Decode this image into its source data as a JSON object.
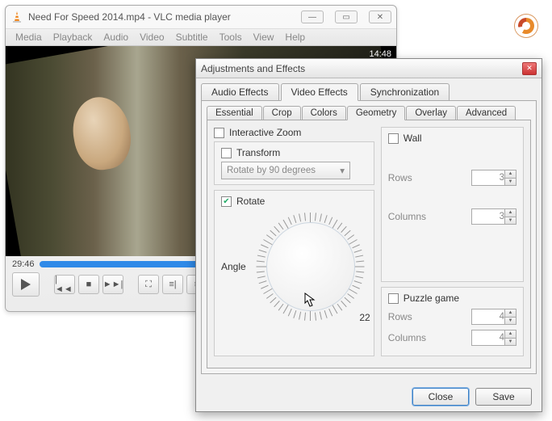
{
  "main": {
    "title": "Need For Speed 2014.mp4 - VLC media player",
    "menu": [
      "Media",
      "Playback",
      "Audio",
      "Video",
      "Subtitle",
      "Tools",
      "View",
      "Help"
    ],
    "video_timestamp": "14:48",
    "elapsed": "29:46"
  },
  "dialog": {
    "title": "Adjustments and Effects",
    "tabs": [
      "Audio Effects",
      "Video Effects",
      "Synchronization"
    ],
    "active_tab": "Video Effects",
    "subtabs": [
      "Essential",
      "Crop",
      "Colors",
      "Geometry",
      "Overlay",
      "Advanced"
    ],
    "active_subtab": "Geometry",
    "geometry": {
      "interactive_zoom": {
        "label": "Interactive Zoom",
        "checked": false
      },
      "transform": {
        "label": "Transform",
        "checked": false,
        "option": "Rotate by 90 degrees"
      },
      "rotate": {
        "label": "Rotate",
        "checked": true,
        "angle_label": "Angle",
        "angle": 22
      },
      "wall": {
        "label": "Wall",
        "checked": false,
        "rows_label": "Rows",
        "rows": 3,
        "cols_label": "Columns",
        "cols": 3
      },
      "puzzle": {
        "label": "Puzzle game",
        "checked": false,
        "rows_label": "Rows",
        "rows": 4,
        "cols_label": "Columns",
        "cols": 4
      }
    },
    "buttons": {
      "close": "Close",
      "save": "Save"
    }
  }
}
